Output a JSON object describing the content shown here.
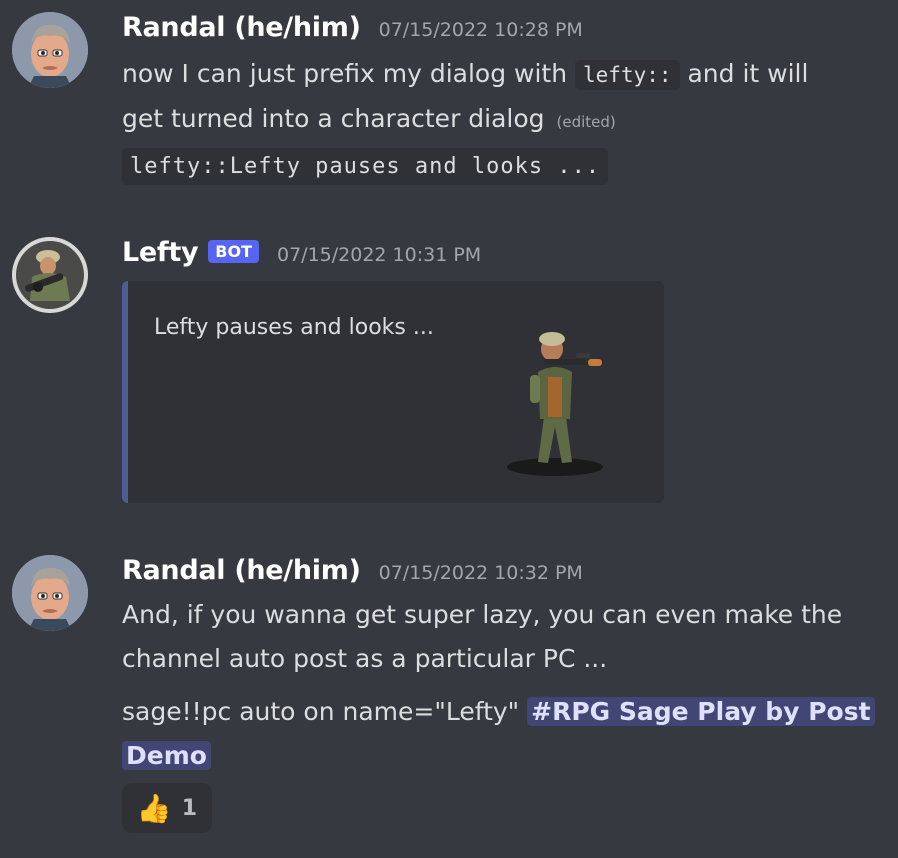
{
  "messages": [
    {
      "username": "Randal (he/him)",
      "timestamp": "07/15/2022 10:28 PM",
      "text_before": "now I can just prefix my dialog with ",
      "inline_code": "lefty::",
      "text_after_line1": " and it will",
      "text_line2": "get turned into a character dialog",
      "edited_label": "(edited)",
      "code_block": "lefty::Lefty pauses and looks ..."
    },
    {
      "username": "Lefty",
      "bot_tag": "BOT",
      "timestamp": "07/15/2022 10:31 PM",
      "embed_text": "Lefty pauses and looks ..."
    },
    {
      "username": "Randal (he/him)",
      "timestamp": "07/15/2022 10:32 PM",
      "line1": "And, if you wanna get super lazy, you can even make the",
      "line2": "channel auto post as a particular PC ...",
      "command_text": "sage!!pc auto on name=\"Lefty\" ",
      "channel_mention_line1": "RPG Sage Play by Post",
      "channel_mention_line2": "Demo",
      "reaction": {
        "emoji": "👍",
        "count": "1"
      }
    }
  ],
  "colors": {
    "background": "#36393f",
    "bot_tag": "#5865f2",
    "embed_border": "#4e5d94",
    "mention_bg": "#414675"
  }
}
